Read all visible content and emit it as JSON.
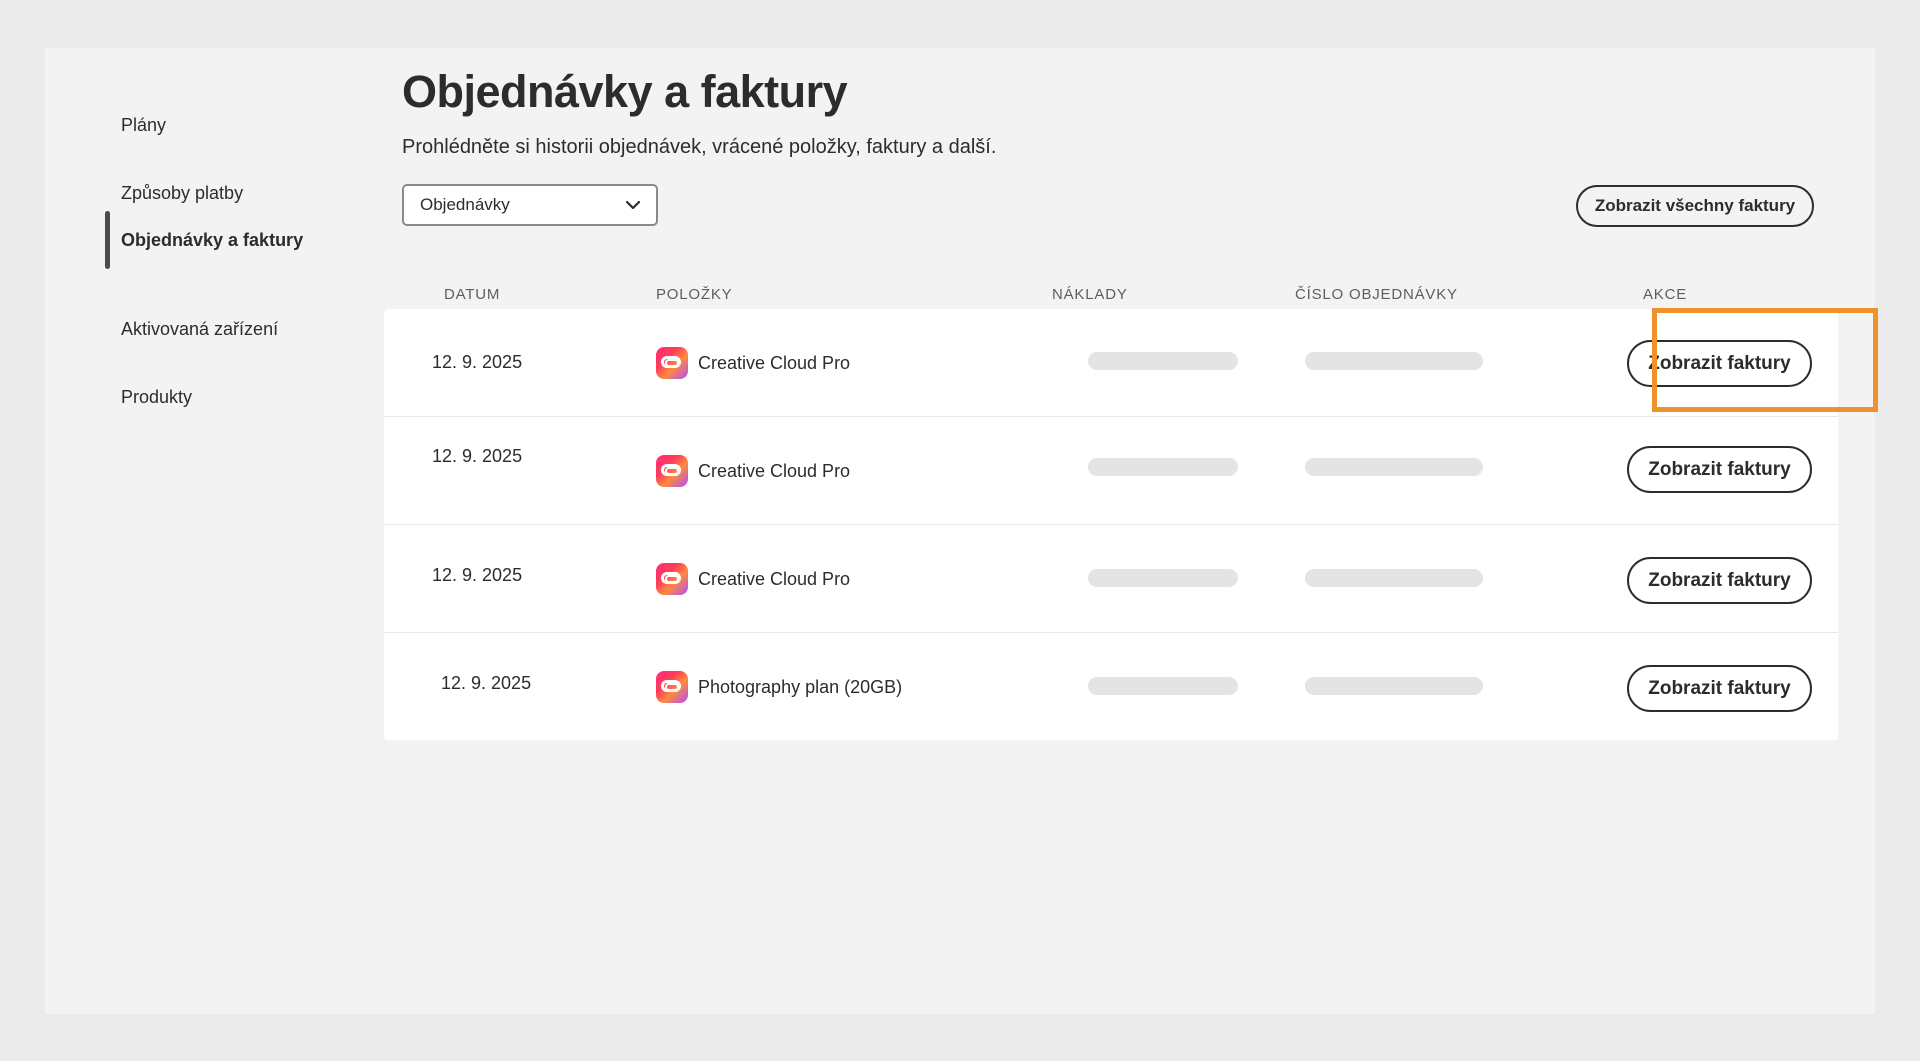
{
  "sidebar": {
    "items": [
      {
        "label": "Plány"
      },
      {
        "label": "Způsoby platby"
      },
      {
        "label": "Objednávky a faktury"
      },
      {
        "label": "Aktivovaná zařízení"
      },
      {
        "label": "Produkty"
      }
    ],
    "active_index": 2
  },
  "main": {
    "title": "Objednávky a faktury",
    "subtitle": "Prohlédněte si historii objednávek, vrácené položky, faktury a další.",
    "filter_select": {
      "value": "Objednávky"
    },
    "view_all_button": "Zobrazit všechny faktury",
    "table": {
      "headers": [
        "DATUM",
        "POLOŽKY",
        "NÁKLADY",
        "ČÍSLO OBJEDNÁVKY",
        "AKCE"
      ],
      "rows": [
        {
          "date": "12. 9. 2025",
          "item": "Creative Cloud Pro",
          "action": "Zobrazit faktury"
        },
        {
          "date": "12. 9. 2025",
          "item": "Creative Cloud Pro",
          "action": "Zobrazit faktury"
        },
        {
          "date": "12. 9. 2025",
          "item": "Creative Cloud Pro",
          "action": "Zobrazit faktury"
        },
        {
          "date": "12. 9. 2025",
          "item": "Photography plan (20GB)",
          "action": "Zobrazit faktury"
        }
      ]
    }
  },
  "colors": {
    "highlight": "#f0922b",
    "background": "#f3f3f3",
    "outer": "#ebebeb"
  },
  "icons": {
    "app": "creative-cloud-icon",
    "dropdown": "chevron-down-icon"
  }
}
